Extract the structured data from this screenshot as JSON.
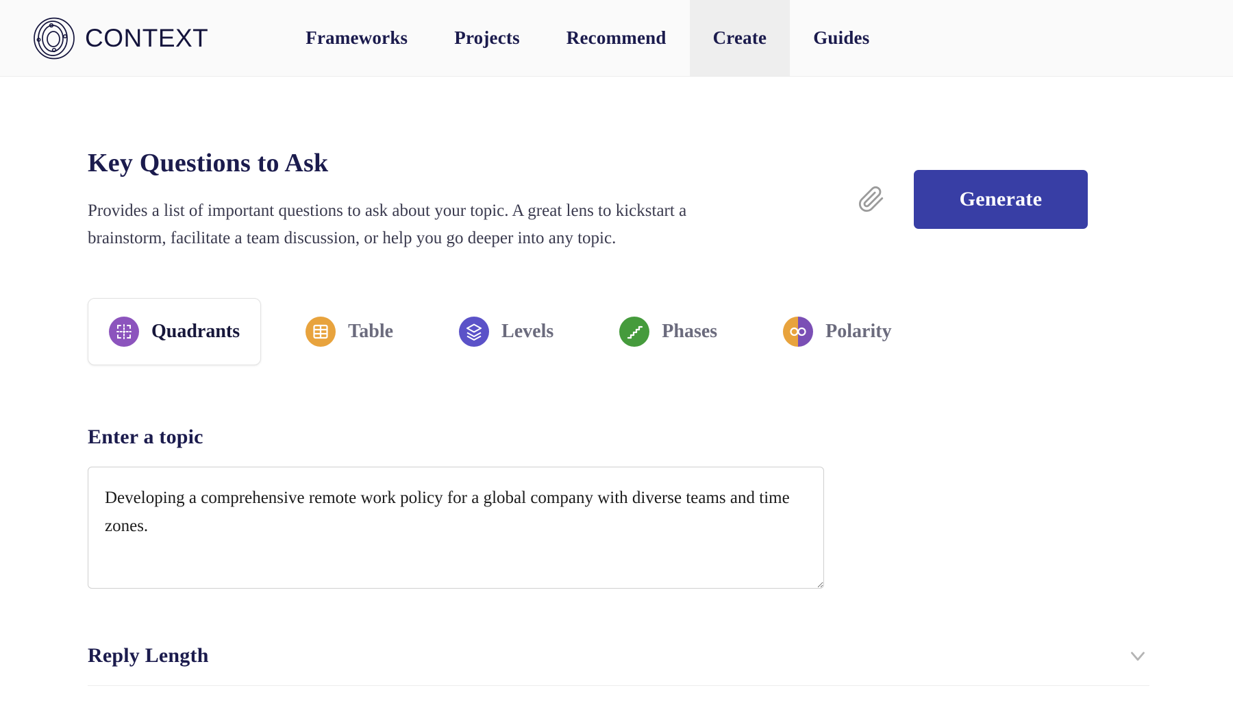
{
  "header": {
    "brand_name": "CONTEXT",
    "logo_icon": "orbit-logo-icon",
    "nav": [
      {
        "label": "Frameworks",
        "active": false
      },
      {
        "label": "Projects",
        "active": false
      },
      {
        "label": "Recommend",
        "active": false
      },
      {
        "label": "Create",
        "active": true
      },
      {
        "label": "Guides",
        "active": false
      }
    ]
  },
  "main": {
    "title": "Key Questions to Ask",
    "description": "Provides a list of important questions to ask about your topic. A great lens to kickstart a brainstorm, facilitate a team discussion, or help you go deeper into any topic.",
    "attach_icon": "paperclip-icon",
    "generate_label": "Generate",
    "generate_color": "#383ea5"
  },
  "formats": {
    "items": [
      {
        "label": "Quadrants",
        "icon": "quadrants-icon",
        "color": "#8c54bd",
        "selected": true
      },
      {
        "label": "Table",
        "icon": "table-icon",
        "color": "#e8a33d",
        "selected": false
      },
      {
        "label": "Levels",
        "icon": "levels-icon",
        "color": "#5b52c8",
        "selected": false
      },
      {
        "label": "Phases",
        "icon": "phases-icon",
        "color": "#459b3c",
        "selected": false
      },
      {
        "label": "Polarity",
        "icon": "polarity-icon",
        "color": "#e8a33d",
        "color_secondary": "#7b4fb5",
        "selected": false
      }
    ]
  },
  "topic": {
    "label": "Enter a topic",
    "value": "Developing a comprehensive remote work policy for a global company with diverse teams and time zones.",
    "placeholder": "Enter a topic"
  },
  "reply_length": {
    "label": "Reply Length",
    "chevron_icon": "chevron-down-icon",
    "expanded": false
  }
}
